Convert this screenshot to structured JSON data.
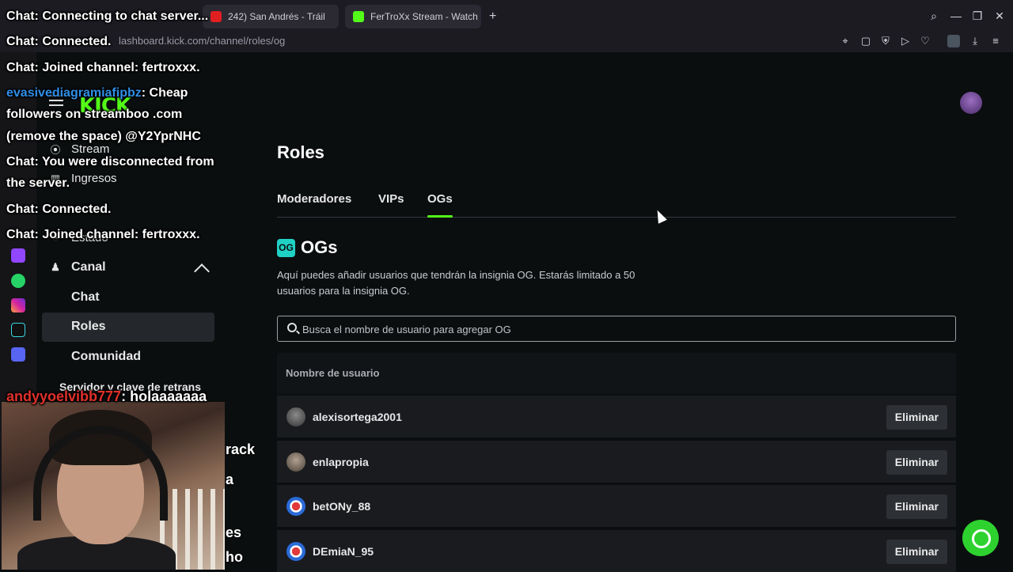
{
  "browser": {
    "tabs": [
      {
        "label": "242) San Andrés - Tráil",
        "icon": "youtube-icon"
      },
      {
        "label": "FerTroXx Stream - Watch",
        "icon": "kick-icon"
      }
    ],
    "new_tab": "+",
    "url": "lashboard.kick.com/channel/roles/og"
  },
  "header": {
    "logo": "KICK"
  },
  "sidebar": {
    "items": [
      {
        "label": "Stream",
        "icon": "broadcast-icon"
      },
      {
        "label": "Ingresos",
        "icon": "chart-icon"
      },
      {
        "label": "Estado",
        "icon": "status-icon"
      },
      {
        "label": "Canal",
        "icon": "channel-icon"
      }
    ],
    "canal_sub": [
      "Chat",
      "Roles",
      "Comunidad"
    ],
    "stream_key": "Servidor y clave de retrans"
  },
  "main": {
    "title": "Roles",
    "tabs": [
      "Moderadores",
      "VIPs",
      "OGs"
    ],
    "active_tab": "OGs",
    "section_badge": "OG",
    "section_title": "OGs",
    "description": "Aquí puedes añadir usuarios que tendrán la insignia OG. Estarás limitado a 50 usuarios para la insignia OG.",
    "search_placeholder": "Busca el nombre de usuario para agregar OG",
    "column_header": "Nombre de usuario",
    "remove_label": "Eliminar",
    "users": [
      "alexisortega2001",
      "enlapropia",
      "betONy_88",
      "DEmiaN_95"
    ]
  },
  "chat_overlay": {
    "lines": [
      {
        "prefix": "Chat:",
        "text": "Connecting to chat server..."
      },
      {
        "prefix": "Chat:",
        "text": "Connected."
      },
      {
        "prefix": "Chat:",
        "text": "Joined channel: fertroxxx."
      },
      {
        "user": "evasivediagramiafipbz",
        "text": ": Cheap"
      },
      {
        "text": "followers on streamboo .com"
      },
      {
        "text": "(remove the space) @Y2YprNHC"
      },
      {
        "prefix": "Chat:",
        "text": "You were disconnected from"
      },
      {
        "text": "the server."
      },
      {
        "prefix": "Chat:",
        "text": "Connected."
      },
      {
        "prefix": "Chat:",
        "text": "Joined channel: fertroxxx."
      },
      {
        "user": "andyyoelvibb777",
        "text": ": holaaaaaaa"
      }
    ],
    "side_fragments": [
      "rack",
      "a",
      "es",
      "ho"
    ]
  },
  "colors": {
    "accent": "#53fc18",
    "og_badge": "#1fd1c4",
    "chat_user": "#2f8fe8",
    "chat_user_alt": "#e0302a"
  }
}
